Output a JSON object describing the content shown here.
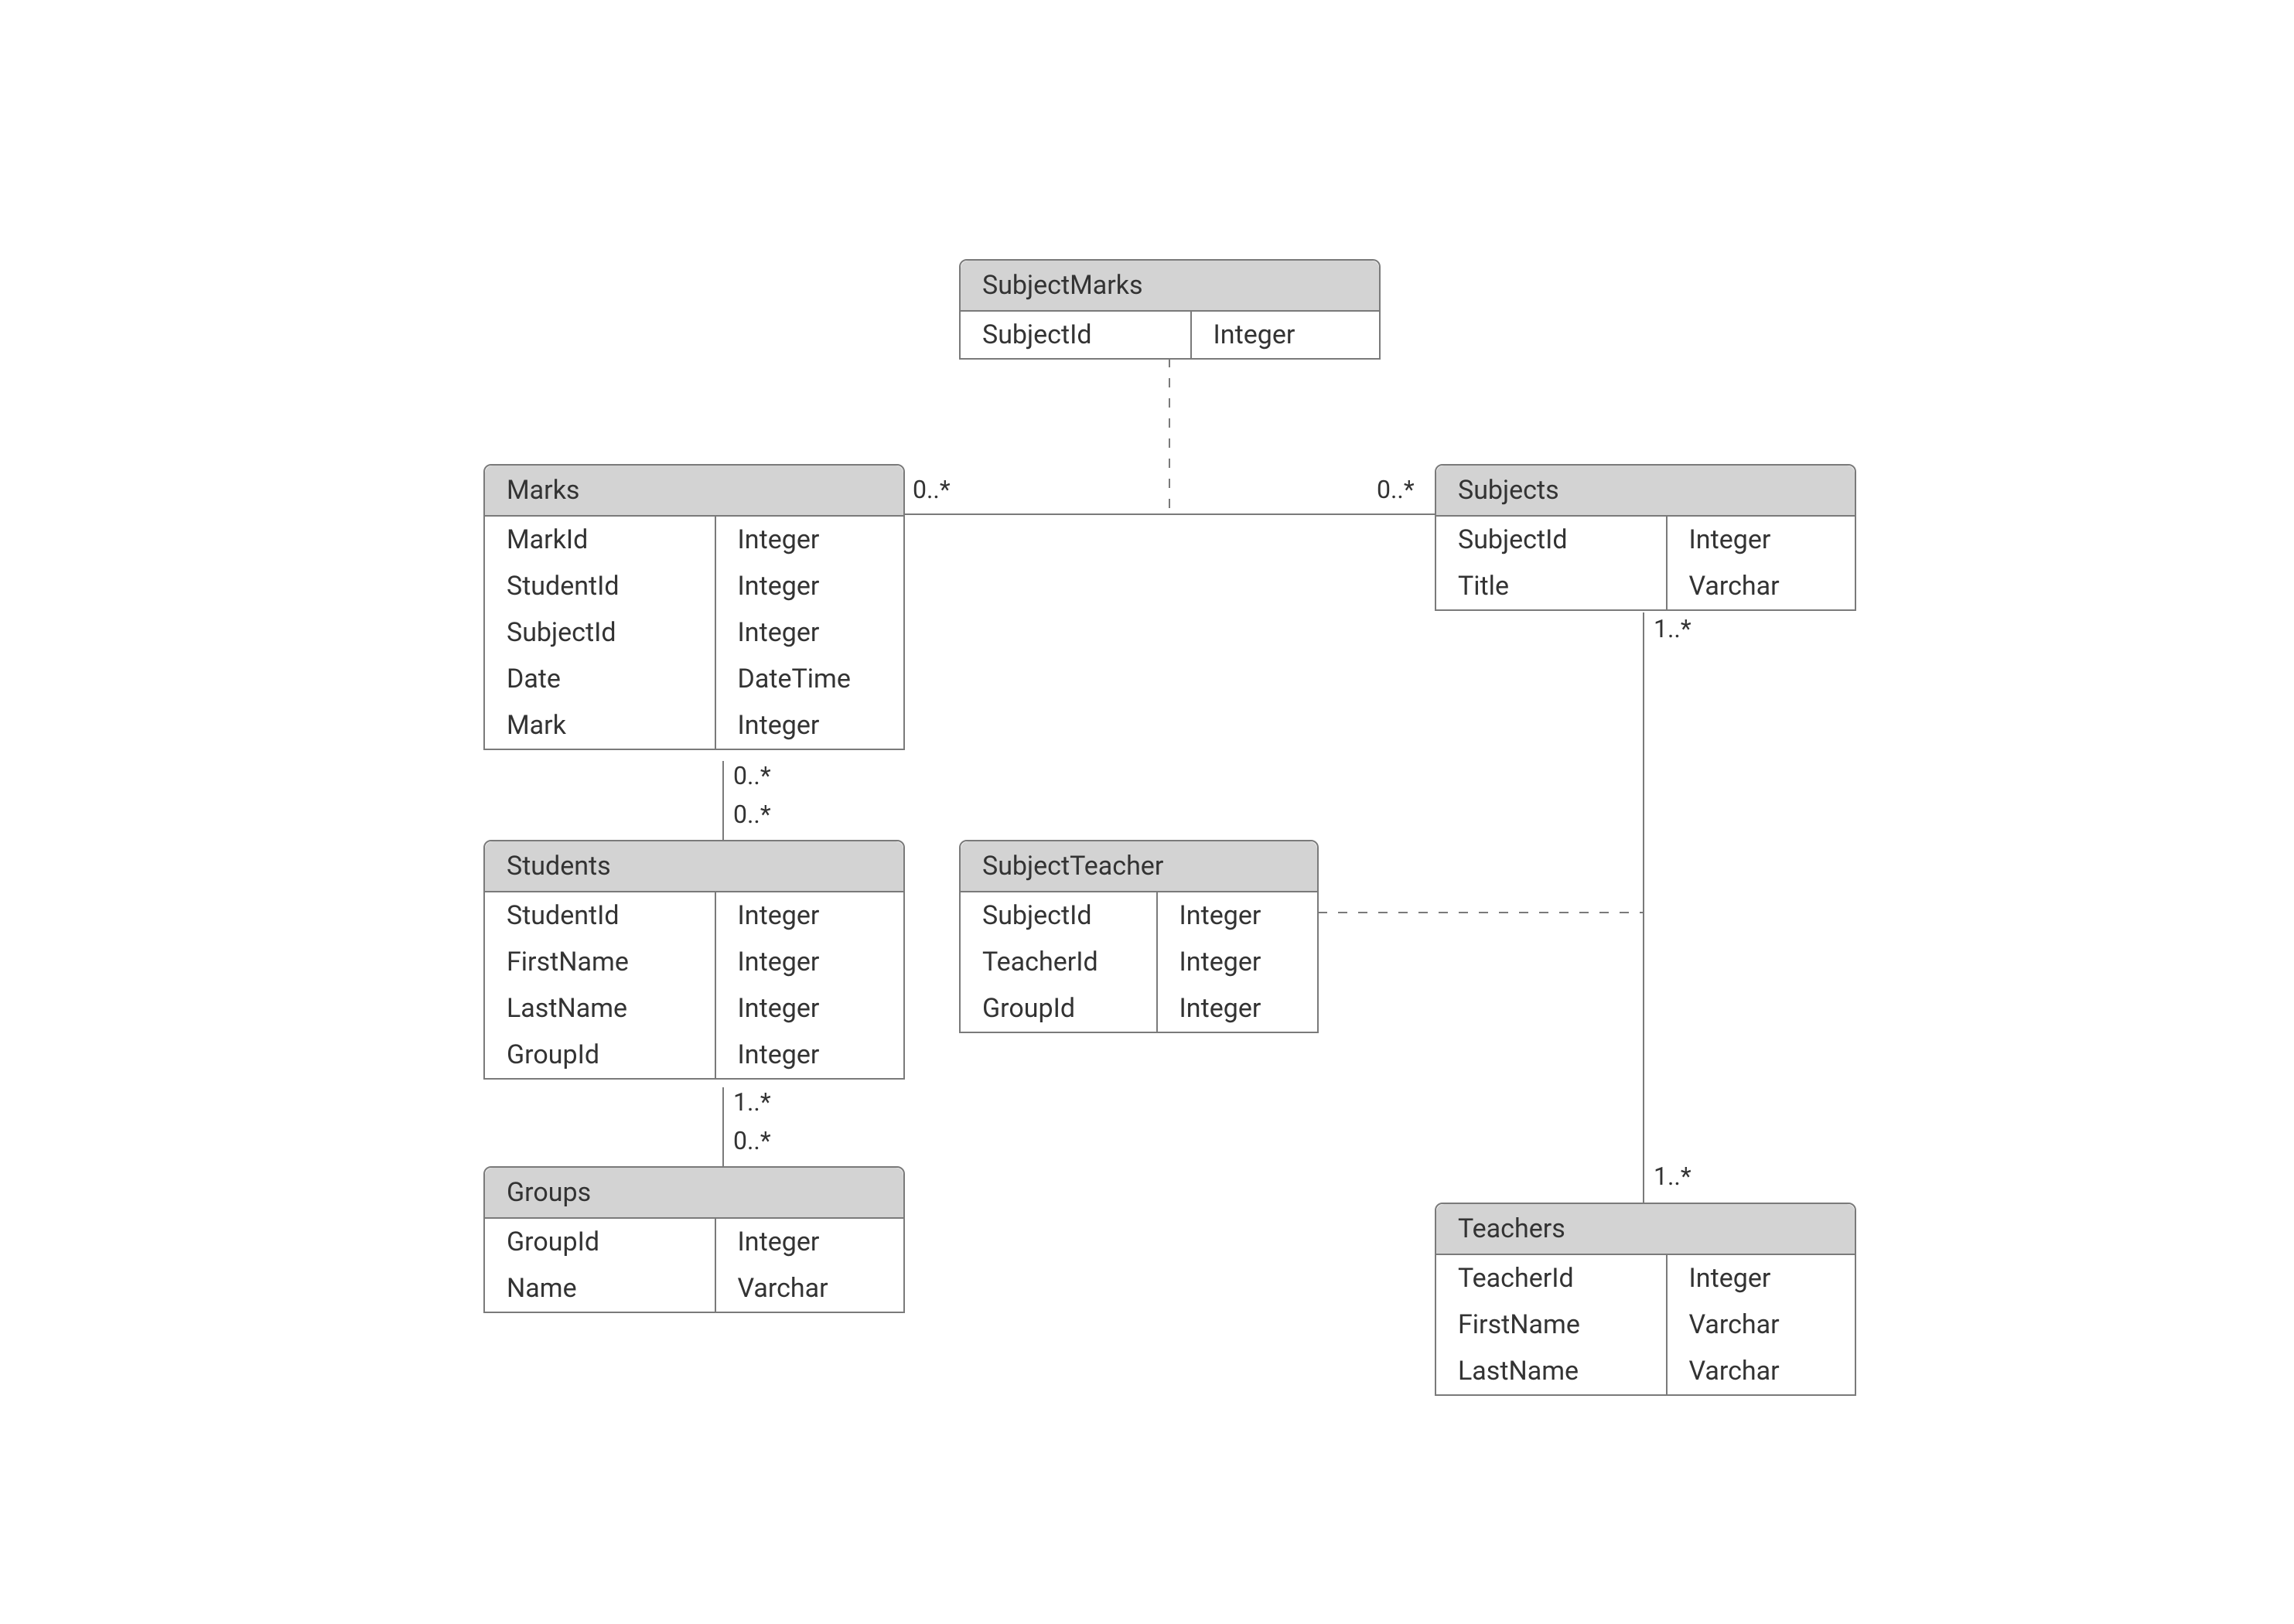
{
  "entities": {
    "subjectMarks": {
      "title": "SubjectMarks",
      "rows": [
        {
          "name": "SubjectId",
          "type": "Integer"
        }
      ]
    },
    "marks": {
      "title": "Marks",
      "rows": [
        {
          "name": "MarkId",
          "type": "Integer"
        },
        {
          "name": "StudentId",
          "type": "Integer"
        },
        {
          "name": "SubjectId",
          "type": "Integer"
        },
        {
          "name": "Date",
          "type": "DateTime"
        },
        {
          "name": "Mark",
          "type": "Integer"
        }
      ]
    },
    "subjects": {
      "title": "Subjects",
      "rows": [
        {
          "name": "SubjectId",
          "type": "Integer"
        },
        {
          "name": "Title",
          "type": "Varchar"
        }
      ]
    },
    "students": {
      "title": "Students",
      "rows": [
        {
          "name": "StudentId",
          "type": "Integer"
        },
        {
          "name": "FirstName",
          "type": "Integer"
        },
        {
          "name": "LastName",
          "type": "Integer"
        },
        {
          "name": "GroupId",
          "type": "Integer"
        }
      ]
    },
    "subjectTeacher": {
      "title": "SubjectTeacher",
      "rows": [
        {
          "name": "SubjectId",
          "type": "Integer"
        },
        {
          "name": "TeacherId",
          "type": "Integer"
        },
        {
          "name": "GroupId",
          "type": "Integer"
        }
      ]
    },
    "groups": {
      "title": "Groups",
      "rows": [
        {
          "name": "GroupId",
          "type": "Integer"
        },
        {
          "name": "Name",
          "type": "Varchar"
        }
      ]
    },
    "teachers": {
      "title": "Teachers",
      "rows": [
        {
          "name": "TeacherId",
          "type": "Integer"
        },
        {
          "name": "FirstName",
          "type": "Varchar"
        },
        {
          "name": "LastName",
          "type": "Varchar"
        }
      ]
    }
  },
  "labels": {
    "marksSubjectsLeft": "0..*",
    "marksSubjectsRight": "0..*",
    "marksStudentsTop": "0..*",
    "marksStudentsBot": "0..*",
    "studentsGroupsTop": "1..*",
    "studentsGroupsBot": "0..*",
    "subjectsTeachersTop": "1..*",
    "subjectsTeachersBot": "1..*"
  }
}
